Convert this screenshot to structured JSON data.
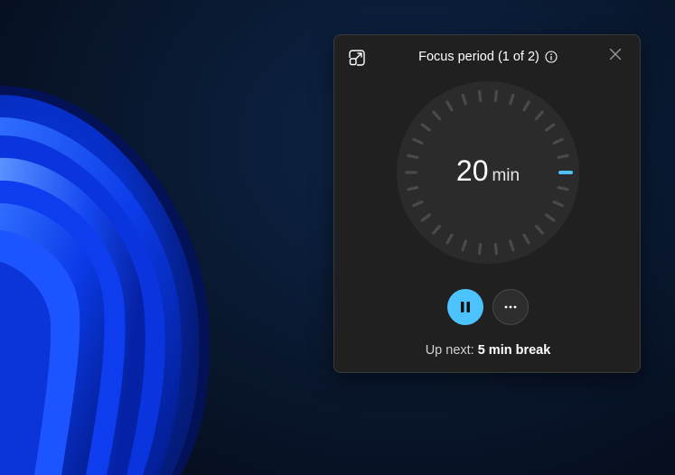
{
  "widget": {
    "title": "Focus period (1 of 2)",
    "timer_value": "20",
    "timer_unit": "min",
    "progress_fraction": 0.0,
    "up_next_label": "Up next:",
    "up_next_value": "5 min break"
  },
  "icons": {
    "compact": "compact-overlay-icon",
    "info": "info-icon",
    "close": "close-icon",
    "pause": "pause-icon",
    "more": "more-options-icon"
  },
  "colors": {
    "accent": "#4cc2ff",
    "panel_bg": "#202020",
    "dial_bg": "#2b2b2b",
    "tick": "#4a4a4a"
  }
}
